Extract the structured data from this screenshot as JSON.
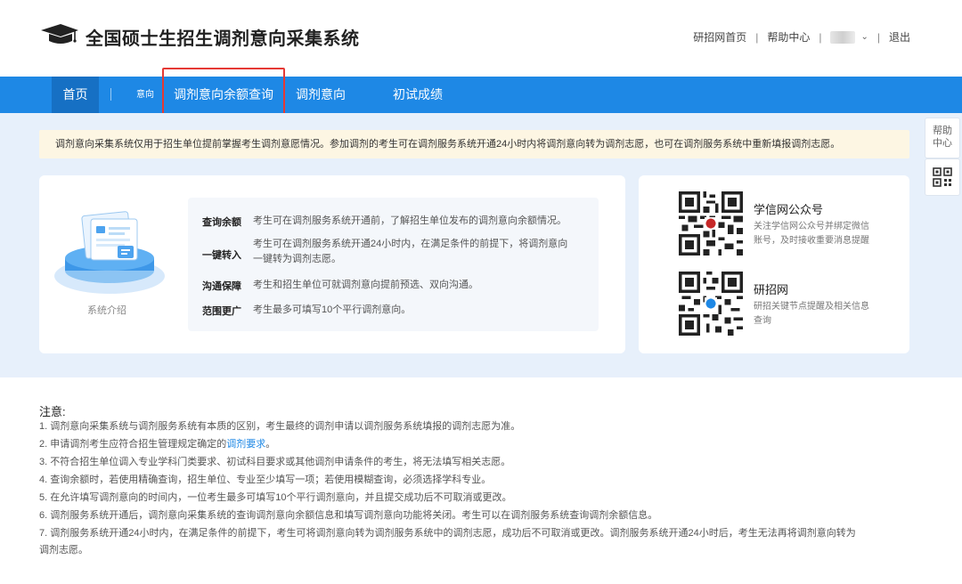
{
  "header": {
    "site_title": "全国硕士生招生调剂意向采集系统",
    "links": {
      "home": "研招网首页",
      "help": "帮助中心",
      "logout": "退出"
    }
  },
  "nav": {
    "home": "首页",
    "small_label": "意向",
    "quota_query": "调剂意向余额查询",
    "intention": "调剂意向",
    "initial_score": "初试成绩"
  },
  "notice": "调剂意向采集系统仅用于招生单位提前掌握考生调剂意愿情况。参加调剂的考生可在调剂服务系统开通24小时内将调剂意向转为调剂志愿，也可在调剂服务系统中重新填报调剂志愿。",
  "side": {
    "help_label": "帮助中心"
  },
  "intro": {
    "caption": "系统介绍",
    "features": [
      {
        "label": "查询余额",
        "desc": "考生可在调剂服务系统开通前，了解招生单位发布的调剂意向余额情况。"
      },
      {
        "label": "一键转入",
        "desc_line1": "考生可在调剂服务系统开通24小时内，在满足条件的前提下，将调剂意向",
        "desc_line2": "一键转为调剂志愿。"
      },
      {
        "label": "沟通保障",
        "desc": "考生和招生单位可就调剂意向提前预选、双向沟通。"
      },
      {
        "label": "范围更广",
        "desc": "考生最多可填写10个平行调剂意向。"
      }
    ]
  },
  "qr_cards": [
    {
      "title": "学信网公众号",
      "desc_line1": "关注学信网公众号并绑定微信",
      "desc_line2": "账号，及时接收重要消息提醒"
    },
    {
      "title": "研招网",
      "desc_line1": "研招关键节点提醒及相关信息",
      "desc_line2": "查询"
    }
  ],
  "notes": {
    "title": "注意:",
    "items": [
      "1. 调剂意向采集系统与调剂服务系统有本质的区别，考生最终的调剂申请以调剂服务系统填报的调剂志愿为准。",
      {
        "prefix": "2. 申请调剂考生应符合招生管理规定确定的",
        "link": "调剂要求",
        "suffix": "。"
      },
      "3. 不符合招生单位调入专业学科门类要求、初试科目要求或其他调剂申请条件的考生，将无法填写相关志愿。",
      "4. 查询余额时，若使用精确查询，招生单位、专业至少填写一项；若使用模糊查询，必须选择学科专业。",
      "5. 在允许填写调剂意向的时间内，一位考生最多可填写10个平行调剂意向，并且提交成功后不可取消或更改。",
      "6. 调剂服务系统开通后，调剂意向采集系统的查询调剂意向余额信息和填写调剂意向功能将关闭。考生可以在调剂服务系统查询调剂余额信息。",
      {
        "line1": "7. 调剂服务系统开通24小时内，在满足条件的前提下，考生可将调剂意向转为调剂服务系统中的调剂志愿，成功后不可取消或更改。调剂服务系统开通24小时后，考生无法再将调剂意向转为",
        "line2": "调剂志愿。"
      }
    ]
  },
  "colors": {
    "nav_blue": "#1e88e5",
    "highlight_red": "#e53935",
    "notice_bg": "#fdf6e3",
    "band_bg": "#e7f0fb"
  }
}
